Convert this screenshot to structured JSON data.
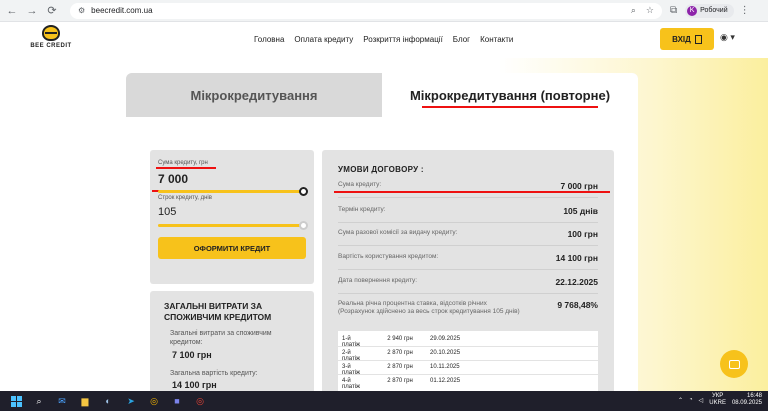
{
  "browser": {
    "url": "beecredit.com.ua",
    "profile_initial": "K",
    "profile_name": "Робочий"
  },
  "header": {
    "logo_text": "BEE CREDIT",
    "nav": [
      "Головна",
      "Оплата кредиту",
      "Розкриття інформації",
      "Блог",
      "Контакти"
    ],
    "login_label": "ВХІД"
  },
  "tabs": {
    "tab1": "Мікрокредитування",
    "tab2": "Мікрокредитування (повторне)"
  },
  "calculator": {
    "amount_label": "Сума кредиту, грн",
    "amount_value": "7 000",
    "amount_slider_fraction": 1.0,
    "term_label": "Строк кредиту, днів",
    "term_value": "105",
    "term_slider_fraction": 1.0,
    "submit_label": "ОФОРМИТИ КРЕДИТ"
  },
  "totals": {
    "title": "ЗАГАЛЬНІ ВИТРАТИ ЗА СПОЖИВЧИМ КРЕДИТОМ",
    "total_cost_label": "Загальні витрати за споживчим кредитом:",
    "total_cost_value": "7 100 грн",
    "total_price_label": "Загальна вартість кредиту:",
    "total_price_value": "14 100 грн"
  },
  "contract": {
    "title": "УМОВИ ДОГОВОРУ :",
    "rows": [
      {
        "label": "Сума кредиту:",
        "value": "7 000 грн"
      },
      {
        "label": "Термін кредиту:",
        "value": "105 днів"
      },
      {
        "label": "Сума разової комісії за видачу кредиту:",
        "value": "100 грн"
      },
      {
        "label": "Вартість користування кредитом:",
        "value": "14 100 грн"
      },
      {
        "label": "Дата повернення кредиту:",
        "value": "22.12.2025"
      },
      {
        "label": "Реальна річна процентна ставка, відсотків річних (Розрахунок здійснено за весь строк кредитування 105 днів)",
        "value": "9 768,48%"
      }
    ],
    "schedule": [
      {
        "n": "1-й платіж",
        "amount": "2 940 грн",
        "date": "29.09.2025"
      },
      {
        "n": "2-й платіж",
        "amount": "2 870 грн",
        "date": "20.10.2025"
      },
      {
        "n": "3-й платіж",
        "amount": "2 870 грн",
        "date": "10.11.2025"
      },
      {
        "n": "4-й платіж",
        "amount": "2 870 грн",
        "date": "01.12.2025"
      }
    ]
  },
  "taskbar": {
    "lang_top": "УКР",
    "lang_bottom": "UKRE",
    "time": "16:48",
    "date": "08.09.2025"
  },
  "colors": {
    "accent": "#f7c21b",
    "highlight_red": "#e11111"
  }
}
